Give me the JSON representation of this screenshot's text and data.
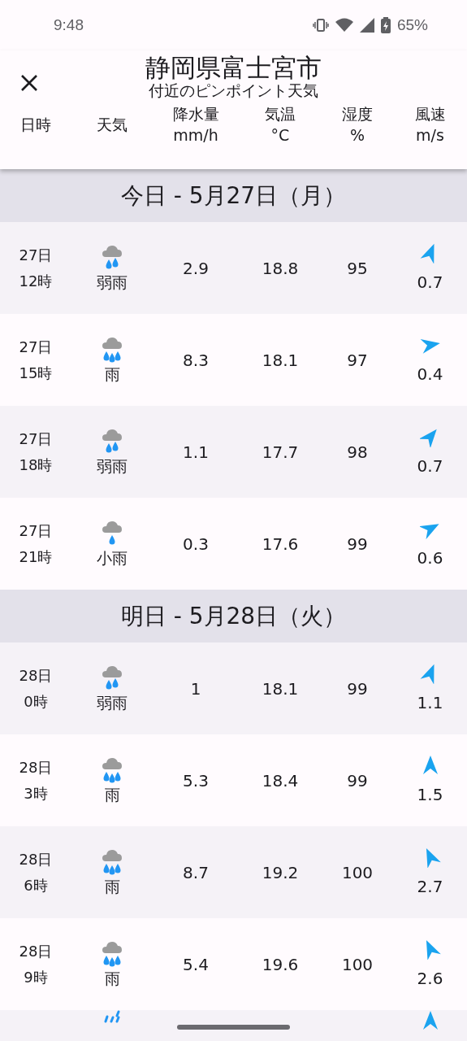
{
  "status_bar": {
    "time": "9:48",
    "battery": "65%"
  },
  "header": {
    "title": "静岡県富士宮市",
    "subtitle": "付近のピンポイント天気"
  },
  "columns": [
    {
      "label": "日時"
    },
    {
      "label": "天気"
    },
    {
      "label": "降水量",
      "unit": "mm/h"
    },
    {
      "label": "気温",
      "unit": "°C"
    },
    {
      "label": "湿度",
      "unit": "%"
    },
    {
      "label": "風速",
      "unit": "m/s"
    }
  ],
  "days": [
    {
      "title": "今日 - 5月27日（月）",
      "rows": [
        {
          "day": "27日",
          "hour": "12時",
          "kind": "light_rain",
          "weather": "弱雨",
          "precip": "2.9",
          "temp": "18.8",
          "humidity": "95",
          "arrow": {
            "kind": "NNE"
          },
          "wind": "0.7"
        },
        {
          "day": "27日",
          "hour": "15時",
          "kind": "rain",
          "weather": "雨",
          "precip": "8.3",
          "temp": "18.1",
          "humidity": "97",
          "arrow": {
            "kind": "E"
          },
          "wind": "0.4"
        },
        {
          "day": "27日",
          "hour": "18時",
          "kind": "light_rain",
          "weather": "弱雨",
          "precip": "1.1",
          "temp": "17.7",
          "humidity": "98",
          "arrow": {
            "kind": "NE"
          },
          "wind": "0.7"
        },
        {
          "day": "27日",
          "hour": "21時",
          "kind": "drizzle",
          "weather": "小雨",
          "precip": "0.3",
          "temp": "17.6",
          "humidity": "99",
          "arrow": {
            "kind": "ENE"
          },
          "wind": "0.6"
        }
      ]
    },
    {
      "title": "明日 - 5月28日（火）",
      "rows": [
        {
          "day": "28日",
          "hour": "0時",
          "kind": "light_rain",
          "weather": "弱雨",
          "precip": "1",
          "temp": "18.1",
          "humidity": "99",
          "arrow": {
            "kind": "NNE"
          },
          "wind": "1.1"
        },
        {
          "day": "28日",
          "hour": "3時",
          "kind": "rain",
          "weather": "雨",
          "precip": "5.3",
          "temp": "18.4",
          "humidity": "99",
          "arrow": {
            "kind": "N"
          },
          "wind": "1.5"
        },
        {
          "day": "28日",
          "hour": "6時",
          "kind": "rain",
          "weather": "雨",
          "precip": "8.7",
          "temp": "19.2",
          "humidity": "100",
          "arrow": {
            "kind": "NNW"
          },
          "wind": "2.7"
        },
        {
          "day": "28日",
          "hour": "9時",
          "kind": "rain",
          "weather": "雨",
          "precip": "5.4",
          "temp": "19.6",
          "humidity": "100",
          "arrow": {
            "kind": "NNW"
          },
          "wind": "2.6"
        },
        {
          "kind": "heavy_rain",
          "arrow": {
            "kind": "N"
          }
        }
      ]
    }
  ]
}
